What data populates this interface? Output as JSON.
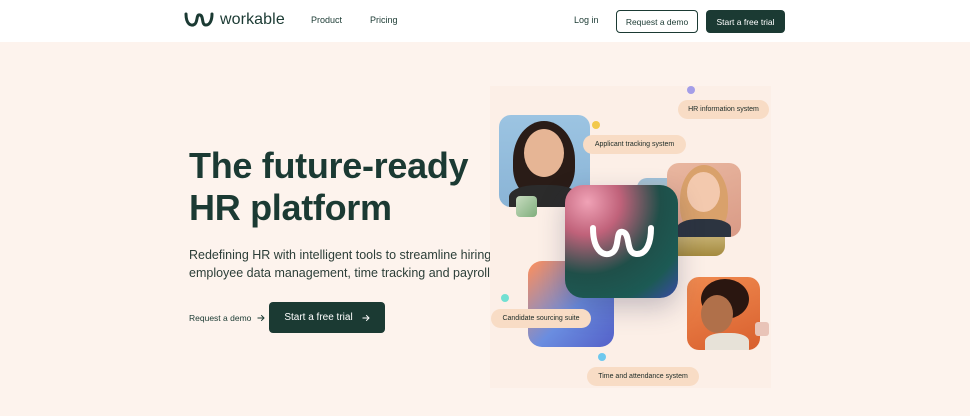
{
  "brand": {
    "name": "workable",
    "color": "#1b3a33",
    "background": "#fdf3ed"
  },
  "nav": {
    "product": "Product",
    "pricing": "Pricing",
    "login": "Log in",
    "request_demo": "Request a demo",
    "free_trial": "Start a free trial"
  },
  "hero": {
    "title_line1": "The future-ready",
    "title_line2": "HR platform",
    "sub_line1": "Redefining HR with intelligent tools to streamline hiring,",
    "sub_line2": "employee data management, time tracking and payroll.",
    "cta_link": "Request a demo",
    "cta_button": "Start a free trial",
    "arrow_icon": "arrow-right-icon"
  },
  "illustration": {
    "pills": {
      "hr": "HR information system",
      "ats": "Applicant tracking system",
      "candidate": "Candidate sourcing suite",
      "time": "Time and attendance system"
    },
    "colors": {
      "purple": "#a49ee8",
      "yellow": "#f2c94c",
      "teal": "#72e0d2",
      "cyan": "#6ec8ee",
      "pill": "#f8dcc5"
    }
  }
}
